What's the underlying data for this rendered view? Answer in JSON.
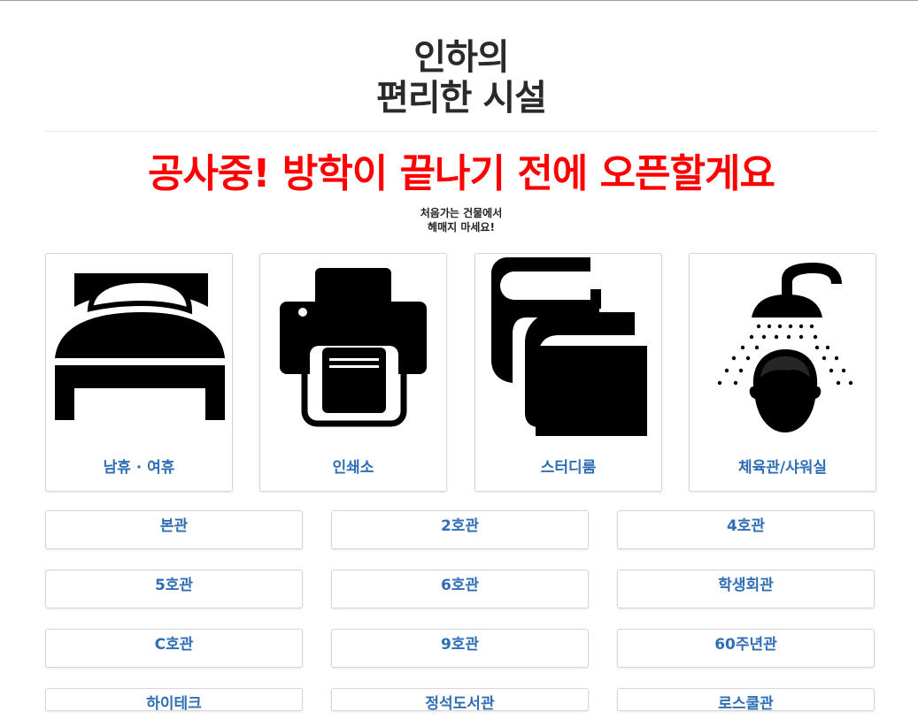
{
  "header": {
    "title_line1": "인하의",
    "title_line2": "편리한 시설"
  },
  "notice": "공사중! 방학이 끝나기 전에 오픈할게요",
  "subnote": {
    "line1": "처음가는 건물에서",
    "line2": "헤매지 마세요!"
  },
  "facilities": [
    {
      "label": "남휴 · 여휴",
      "icon": "bed-icon"
    },
    {
      "label": "인쇄소",
      "icon": "printer-icon"
    },
    {
      "label": "스터디룸",
      "icon": "books-icon"
    },
    {
      "label": "체육관/샤워실",
      "icon": "shower-icon"
    }
  ],
  "buildings": [
    "본관",
    "2호관",
    "4호관",
    "5호관",
    "6호관",
    "학생회관",
    "C호관",
    "9호관",
    "60주년관",
    "하이테크",
    "정석도서관",
    "로스쿨관"
  ],
  "colors": {
    "notice": "#ff0000",
    "link": "#2f6db5",
    "title": "#2a2a2a"
  }
}
